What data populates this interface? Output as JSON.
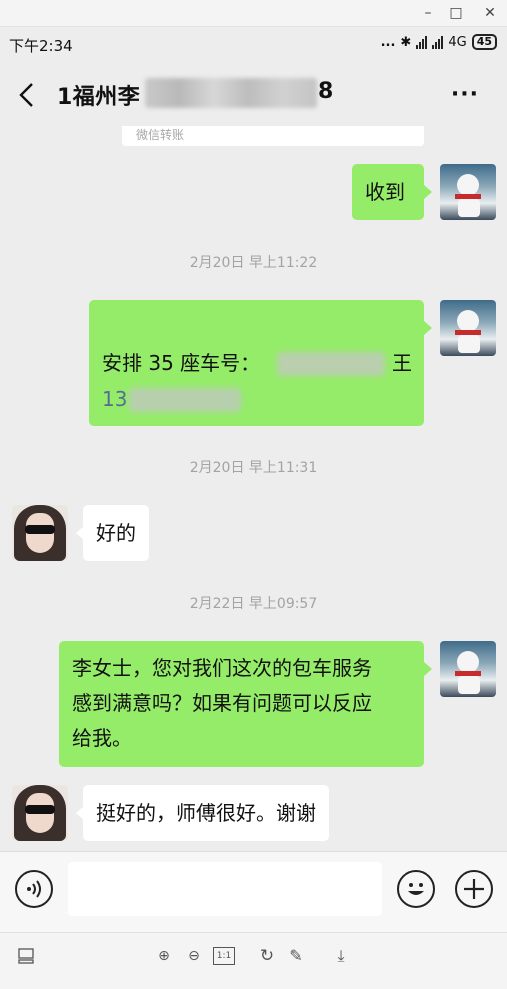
{
  "window_controls": {
    "minimize": "–",
    "maximize": "□",
    "close": "✕"
  },
  "status_bar": {
    "time": "下午2:34",
    "dots": "...",
    "network": "4G",
    "battery": "45"
  },
  "header": {
    "title": "1福州李",
    "title_suffix": "8",
    "more": "···"
  },
  "chat": {
    "transfer_label": "微信转账",
    "messages": [
      {
        "side": "right",
        "text": "收到"
      },
      {
        "timestamp": "2月20日 早上11:22"
      },
      {
        "side": "right",
        "text_line1": "安排 35 座车号：",
        "text_line1_end": "王",
        "text_line2": "13"
      },
      {
        "timestamp": "2月20日 早上11:31"
      },
      {
        "side": "left",
        "text": "好的"
      },
      {
        "timestamp": "2月22日 早上09:57"
      },
      {
        "side": "right",
        "lines": [
          "李女士，您对我们这次的包车服务",
          "感到满意吗？如果有问题可以反应",
          "给我。"
        ]
      },
      {
        "side": "left",
        "text": "挺好的，师傅很好。谢谢"
      }
    ]
  },
  "input_bar": {
    "input_value": ""
  },
  "toolbar": {
    "zoom_in": "⊕",
    "zoom_out": "⊖",
    "actual_size": "1:1",
    "rotate": "↻",
    "edit": "✎",
    "download": "⤓"
  },
  "colors": {
    "bubble_green": "#95ec69",
    "background": "#ededed",
    "link": "#576b95"
  }
}
